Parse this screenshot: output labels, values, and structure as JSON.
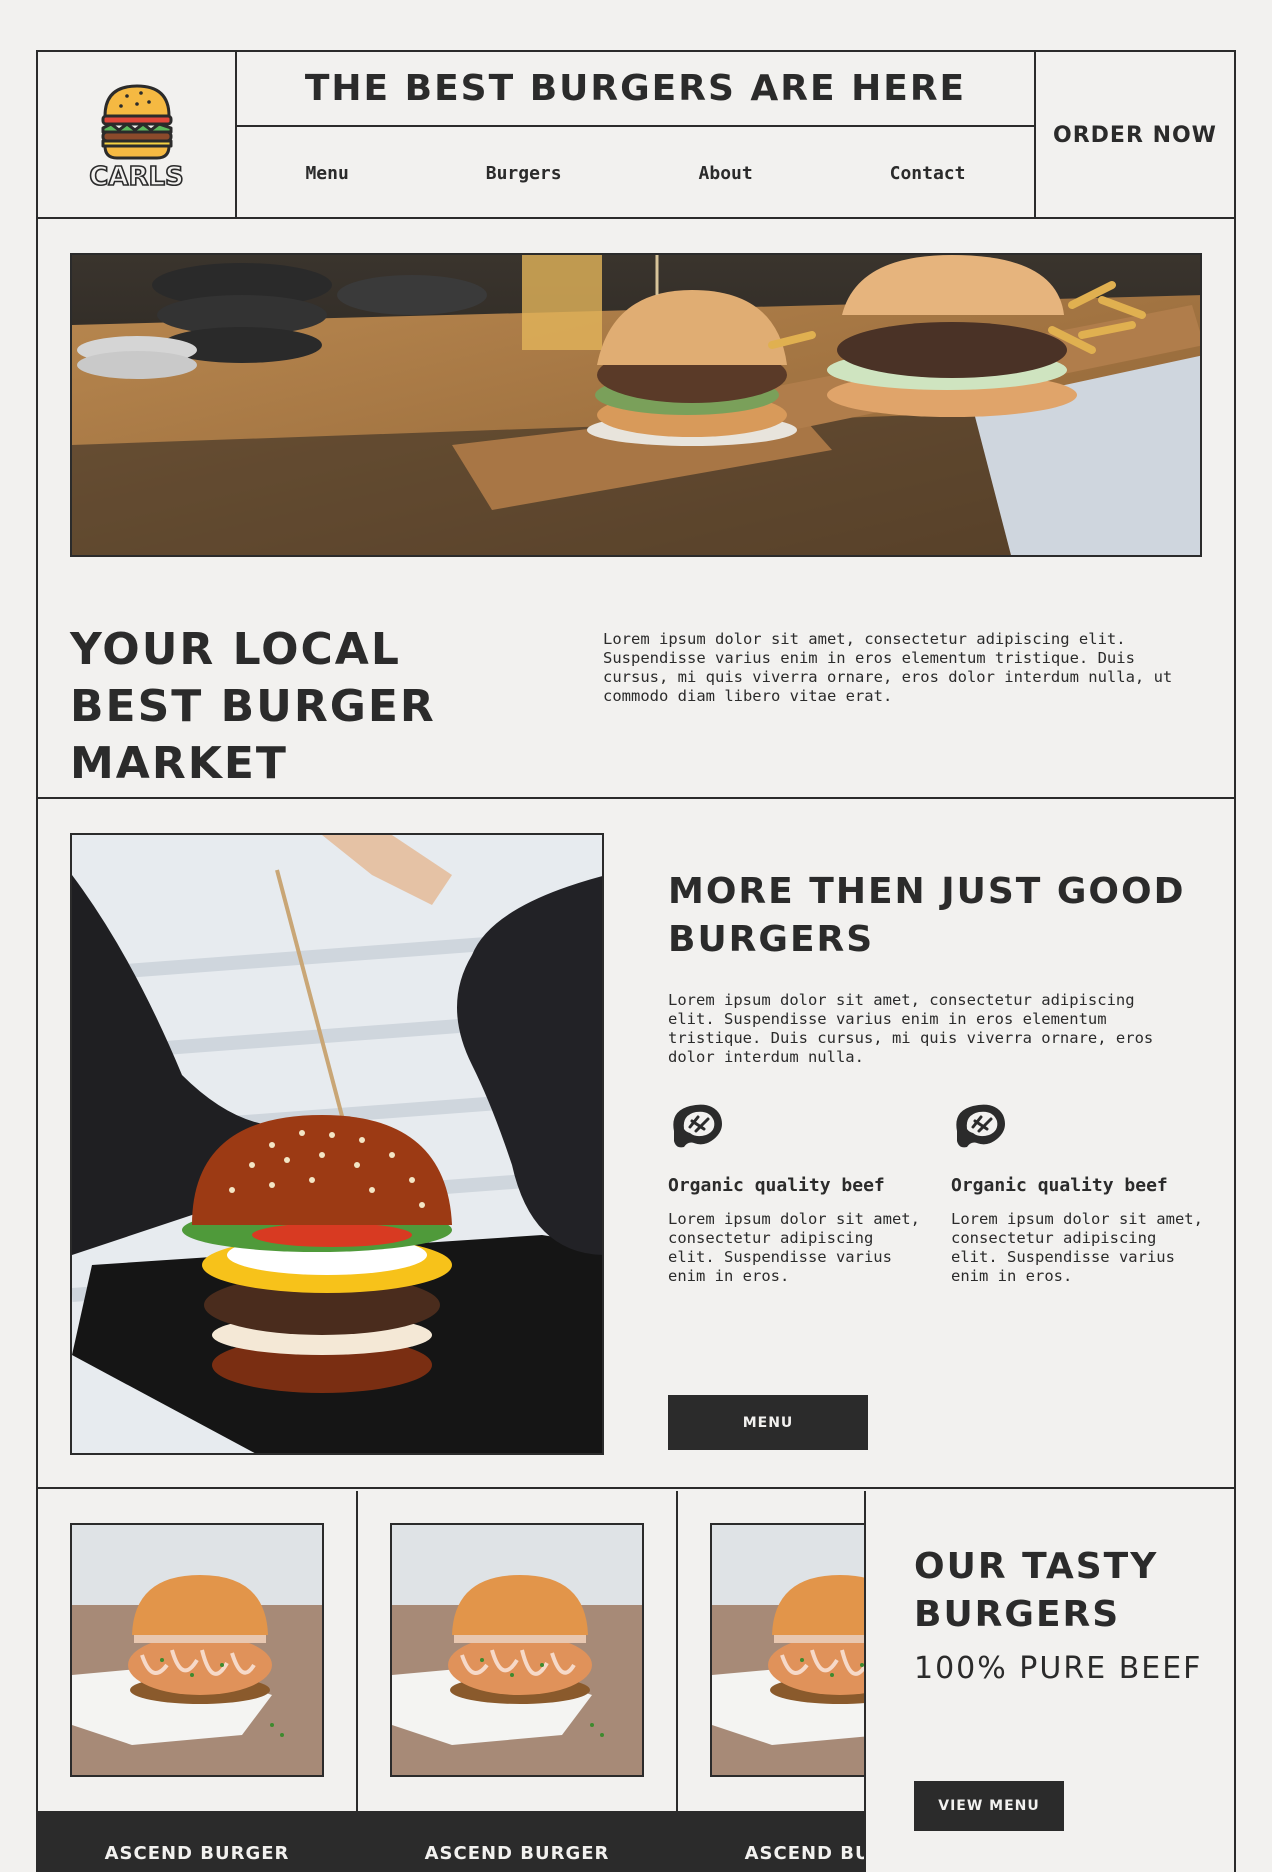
{
  "brand": {
    "logo_text": "CARLS",
    "logo_icon": "burger-icon"
  },
  "header": {
    "title": "THE BEST BURGERS ARE HERE",
    "nav": [
      "Menu",
      "Burgers",
      "About",
      "Contact"
    ],
    "order_label": "ORDER NOW"
  },
  "hero": {
    "image": "burgers-on-wooden-boards-photo",
    "title": "YOUR LOCAL BEST BURGER MARKET",
    "text": "Lorem ipsum dolor sit amet, consectetur adipiscing elit. Suspendisse varius enim in eros elementum tristique. Duis cursus, mi quis viverra ornare, eros dolor interdum nulla, ut commodo diam libero vitae erat."
  },
  "about": {
    "image": "gloved-hands-burger-photo",
    "title": "MORE THEN JUST GOOD BURGERS",
    "text": "Lorem ipsum dolor sit amet, consectetur adipiscing elit. Suspendisse varius enim in eros elementum tristique. Duis cursus, mi quis viverra ornare, eros dolor interdum nulla.",
    "features": [
      {
        "icon": "steak-icon",
        "title": "Organic quality beef",
        "text": "Lorem ipsum dolor sit amet, consectetur adipiscing elit. Suspendisse varius enim in eros."
      },
      {
        "icon": "steak-icon",
        "title": "Organic quality beef",
        "text": "Lorem ipsum dolor sit amet, consectetur adipiscing elit. Suspendisse varius enim in eros."
      }
    ],
    "button_label": "MENU"
  },
  "burgers": {
    "cards": [
      {
        "name": "ASCEND BURGER",
        "image": "chicken-burger-photo"
      },
      {
        "name": "ASCEND BURGER",
        "image": "chicken-burger-photo"
      },
      {
        "name": "ASCEND BURGER",
        "image": "chicken-burger-photo"
      }
    ],
    "title": "OUR TASTY BURGERS",
    "subtitle": "100% PURE BEEF",
    "button_label": "VIEW MENU"
  },
  "colors": {
    "background": "#f2f1ef",
    "ink": "#2b2b2b",
    "bun": "#f5b942"
  }
}
